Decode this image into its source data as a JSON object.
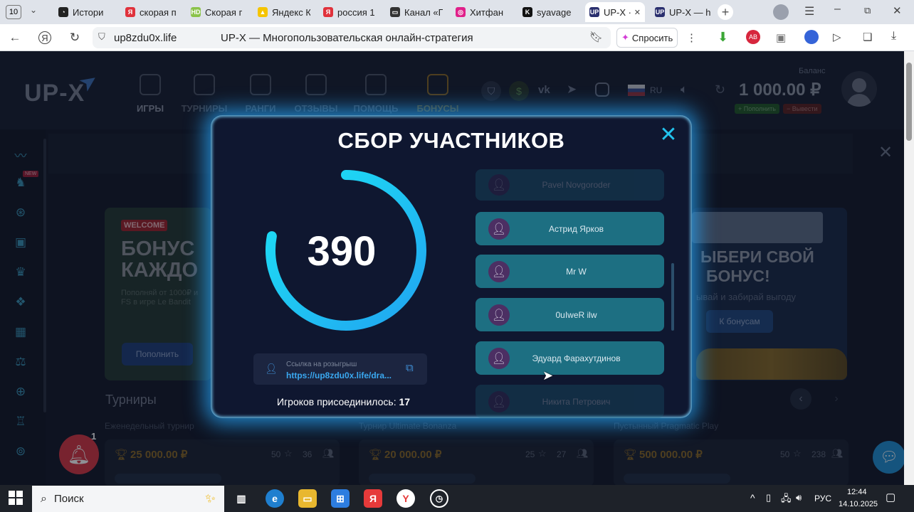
{
  "browser": {
    "tab_counter": "10",
    "tabs": [
      {
        "label": "Истори",
        "fav_color": "#222",
        "fav_glyph": "◔"
      },
      {
        "label": "скорая п",
        "fav_color": "#e0323c",
        "fav_glyph": "Я"
      },
      {
        "label": "Скорая г",
        "fav_color": "#8bc34a",
        "fav_glyph": "HD"
      },
      {
        "label": "Яндекс К",
        "fav_color": "#f5c400",
        "fav_glyph": "▲"
      },
      {
        "label": "россия 1",
        "fav_color": "#e0323c",
        "fav_glyph": "Я"
      },
      {
        "label": "Канал «Г",
        "fav_color": "#333",
        "fav_glyph": "▭"
      },
      {
        "label": "Хитфан",
        "fav_color": "#e0208a",
        "fav_glyph": "◎"
      },
      {
        "label": "syavage",
        "fav_color": "#111",
        "fav_glyph": "K"
      },
      {
        "label": "UP-X ·",
        "fav_color": "#2a2f6e",
        "fav_glyph": "UP"
      },
      {
        "label": "UP-X — h",
        "fav_color": "#2a2f6e",
        "fav_glyph": "UP"
      }
    ],
    "url": "up8zdu0x.life",
    "page_title": "UP-X — Многопользовательская онлайн-стратегия",
    "ask_button": "Спросить"
  },
  "site": {
    "logo": "UP-X",
    "menu": [
      "ИГРЫ",
      "ТУРНИРЫ",
      "РАНГИ",
      "ОТЗЫВЫ",
      "ПОМОЩЬ",
      "БОНУСЫ"
    ],
    "lang": "RU",
    "balance_label": "Баланс",
    "balance": "1 000.00 ₽",
    "deposit": "+ Пополнить",
    "withdraw": "− Вывести",
    "new_badge": "NEW",
    "welcome_badge": "WELCOME",
    "promo_left_title1": "БОНУС",
    "promo_left_title2": "КАЖДО",
    "promo_left_sub1": "Пополняй от 1000₽ и",
    "promo_left_sub2": "FS в игре Le Bandit",
    "promo_left_button": "Пополнить",
    "promo_right_title1": "ЫБЕРИ СВОЙ",
    "promo_right_title2": "БОНУС!",
    "promo_right_sub": "ывай и забирай выгоду",
    "promo_right_button": "К бонусам",
    "tournaments_title": "Турниры",
    "tournaments": [
      {
        "name": "Еженедельный турнир",
        "prize": "25 000.00 ₽",
        "stars": "50",
        "users": "36"
      },
      {
        "name": "Турнир Ultimate Bonanza",
        "prize": "20 000.00 ₽",
        "stars": "25",
        "users": "27"
      },
      {
        "name": "Пустынный Pragmatic Play",
        "prize": "500 000.00 ₽",
        "stars": "50",
        "users": "238"
      }
    ],
    "notification_count": "1"
  },
  "modal": {
    "title": "СБОР УЧАСТНИКОВ",
    "countdown": "390",
    "countdown_progress": 0.78,
    "link_label": "Ссылка на розыгрыш",
    "link_value": "https://up8zdu0x.life/dra...",
    "players_label": "Игроков присоединилось:",
    "players_count": "17",
    "participants": [
      "Pavel Novgoroder",
      "Астрид Ярков",
      "Mr W",
      "0uIweR ilw",
      "Эдуард Фарахутдинов",
      "Никита Петрович"
    ]
  },
  "taskbar": {
    "search": "Поиск",
    "lang": "РУС",
    "time": "12:44",
    "date": "14.10.2025"
  }
}
